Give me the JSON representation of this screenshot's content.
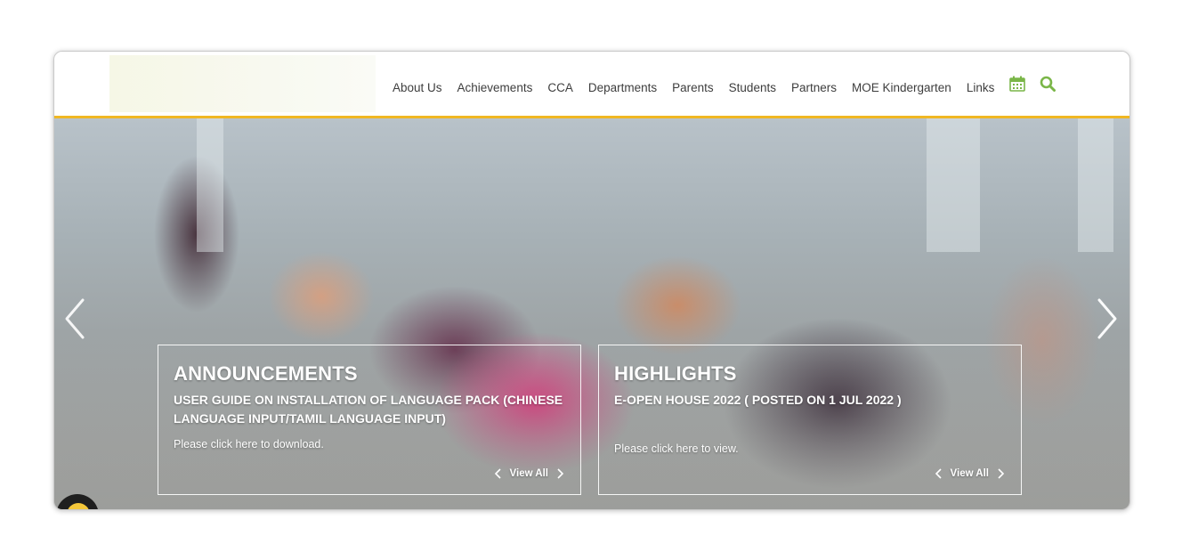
{
  "header": {
    "logo_alt": "",
    "nav": [
      {
        "label": "About Us"
      },
      {
        "label": "Achievements"
      },
      {
        "label": "CCA"
      },
      {
        "label": "Departments"
      },
      {
        "label": "Parents"
      },
      {
        "label": "Students"
      },
      {
        "label": "Partners"
      },
      {
        "label": "MOE Kindergarten"
      },
      {
        "label": "Links"
      }
    ],
    "icons": {
      "calendar": "calendar-icon",
      "search": "search-icon"
    },
    "accent_color": "#7ab648",
    "border_color": "#f0b723"
  },
  "carousel": {
    "prev_icon": "chevron-left-icon",
    "next_icon": "chevron-right-icon"
  },
  "announcements": {
    "title": "ANNOUNCEMENTS",
    "headline": "USER GUIDE ON INSTALLATION OF LANGUAGE PACK (CHINESE LANGUAGE INPUT/TAMIL LANGUAGE INPUT)",
    "description": "Please click here to download.",
    "view_all": "View All"
  },
  "highlights": {
    "title": "HIGHLIGHTS",
    "headline": "E-OPEN HOUSE 2022 ( POSTED ON 1 JUL 2022 )",
    "description": "Please click here to view.",
    "view_all": "View All"
  }
}
